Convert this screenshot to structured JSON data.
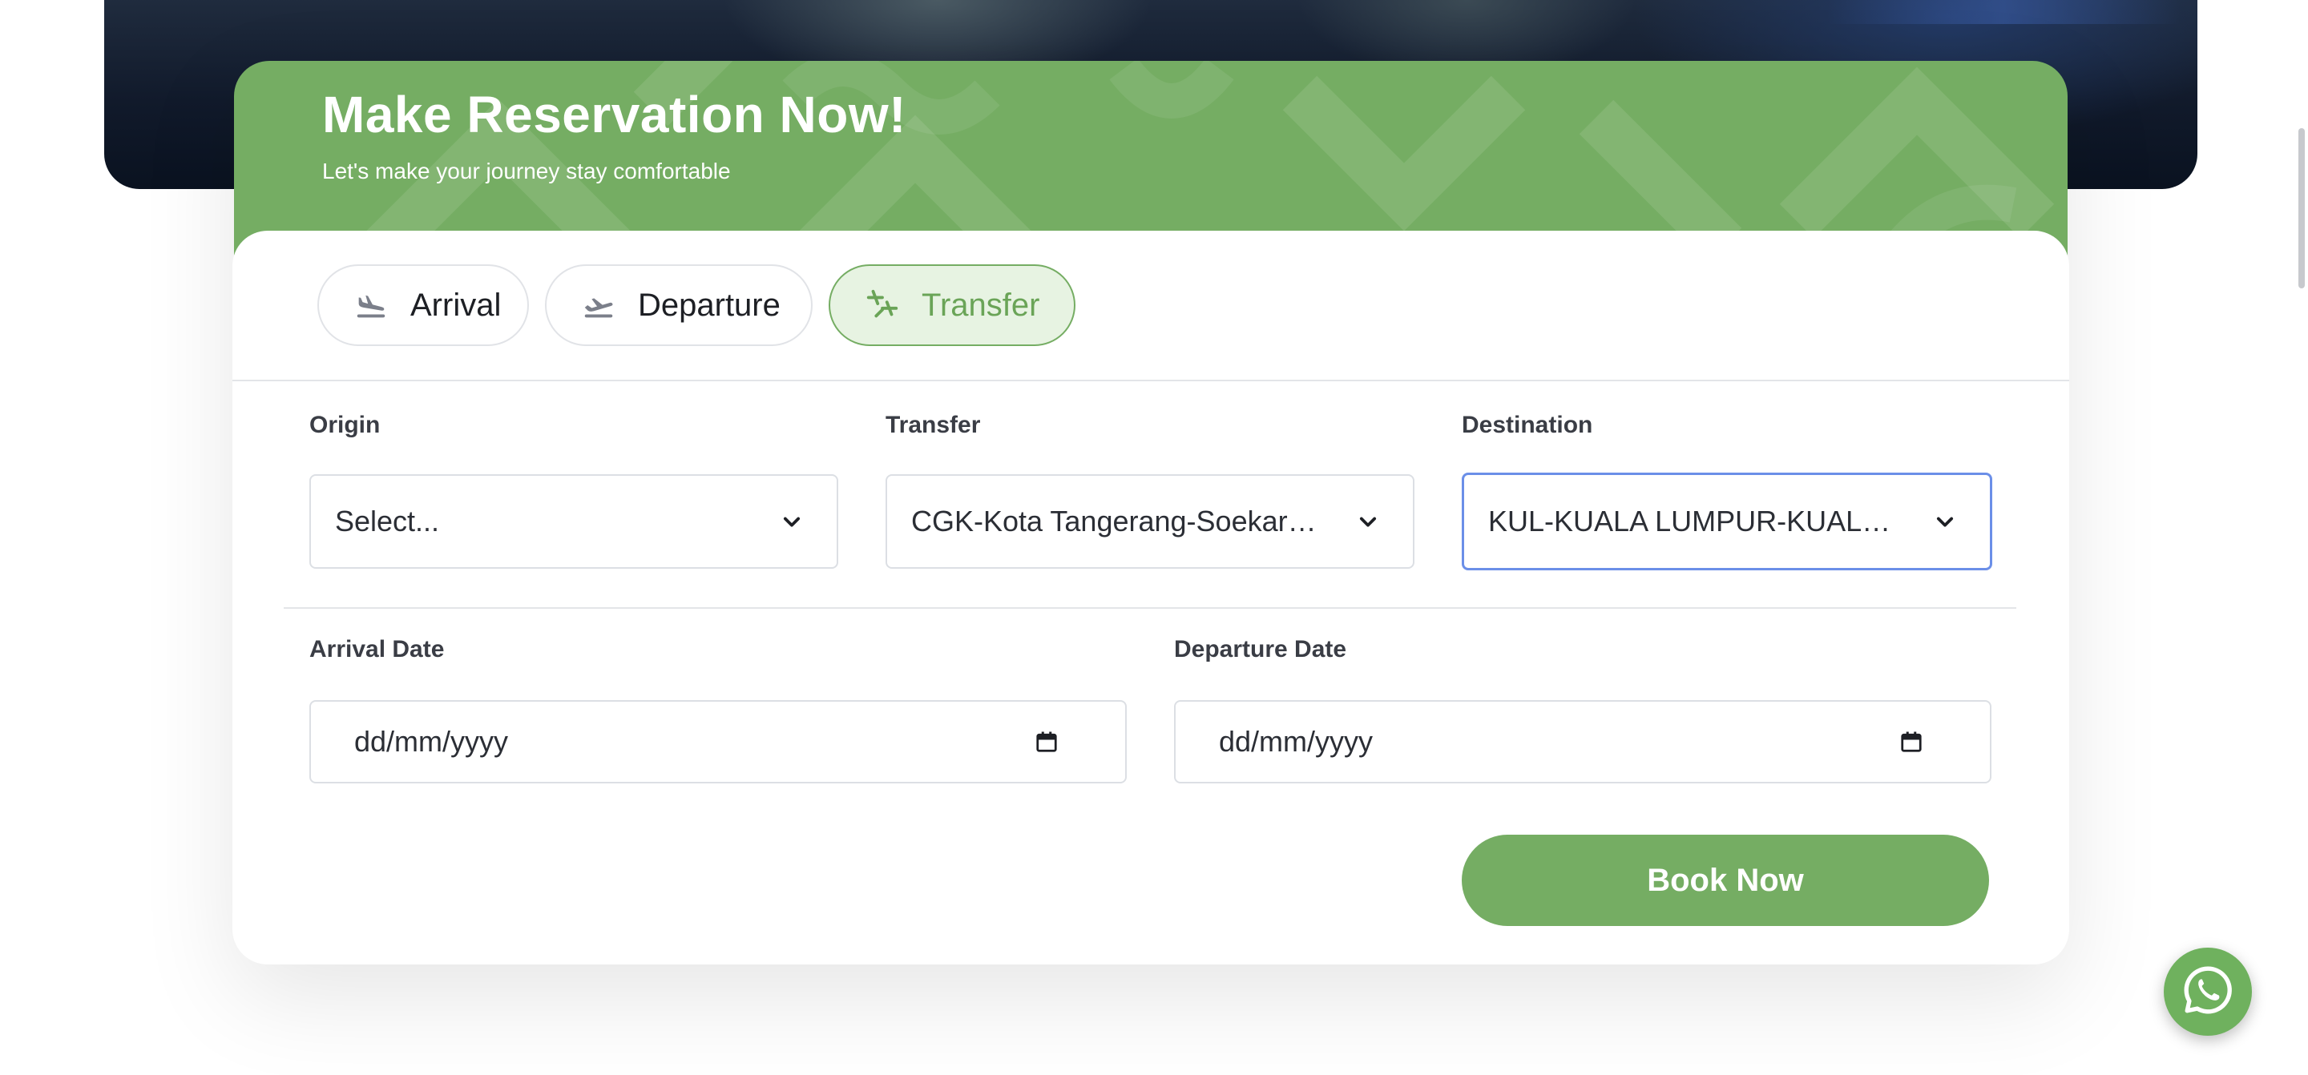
{
  "header": {
    "title": "Make Reservation Now!",
    "subtitle": "Let's make your journey stay comfortable"
  },
  "tabs": [
    {
      "label": "Arrival",
      "icon": "plane-landing-icon",
      "active": false
    },
    {
      "label": "Departure",
      "icon": "plane-takeoff-icon",
      "active": false
    },
    {
      "label": "Transfer",
      "icon": "plane-transfer-icon",
      "active": true
    }
  ],
  "form": {
    "origin": {
      "label": "Origin",
      "value": "Select..."
    },
    "transfer": {
      "label": "Transfer",
      "value": "CGK-Kota Tangerang-Soekarno-Hatta"
    },
    "destination": {
      "label": "Destination",
      "value": "KUL-KUALA LUMPUR-KUALA LUMPUR"
    },
    "arrival_date": {
      "label": "Arrival Date",
      "placeholder": "dd/mm/yyyy"
    },
    "departure_date": {
      "label": "Departure Date",
      "placeholder": "dd/mm/yyyy"
    }
  },
  "book_button": "Book Now",
  "colors": {
    "brand_green": "#75ad63",
    "active_tab_bg": "#e7f3e2",
    "focus_border": "#6b8fe8"
  },
  "floating": {
    "icon": "whatsapp-icon"
  }
}
